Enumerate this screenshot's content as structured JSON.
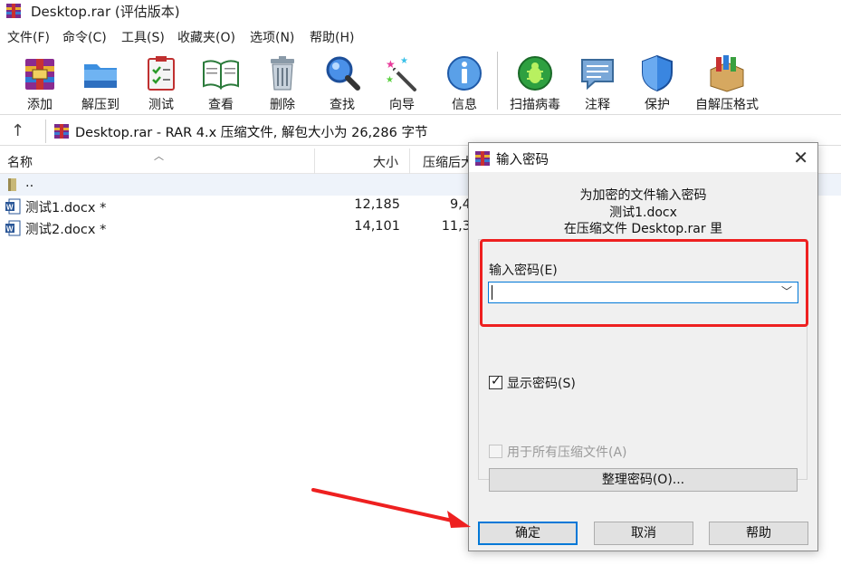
{
  "window": {
    "title": "Desktop.rar (评估版本)"
  },
  "menu": [
    "文件(F)",
    "命令(C)",
    "工具(S)",
    "收藏夹(O)",
    "选项(N)",
    "帮助(H)"
  ],
  "toolbar": [
    {
      "label": "添加",
      "icon": "add-archive-icon"
    },
    {
      "label": "解压到",
      "icon": "extract-folder-icon"
    },
    {
      "label": "测试",
      "icon": "test-clipboard-icon"
    },
    {
      "label": "查看",
      "icon": "view-book-icon"
    },
    {
      "label": "删除",
      "icon": "trash-icon"
    },
    {
      "label": "查找",
      "icon": "magnifier-icon"
    },
    {
      "label": "向导",
      "icon": "wizard-wand-icon"
    },
    {
      "label": "信息",
      "icon": "info-icon"
    },
    {
      "label": "扫描病毒",
      "icon": "virus-scan-icon"
    },
    {
      "label": "注释",
      "icon": "comment-bubble-icon"
    },
    {
      "label": "保护",
      "icon": "shield-icon"
    },
    {
      "label": "自解压格式",
      "icon": "sfx-box-icon"
    }
  ],
  "address": {
    "text": "Desktop.rar - RAR 4.x 压缩文件, 解包大小为 26,286 字节"
  },
  "columns": {
    "name": "名称",
    "size": "大小",
    "packed": "压缩后大"
  },
  "files": [
    {
      "name": "..",
      "size": "",
      "packed": ""
    },
    {
      "name": "测试1.docx *",
      "size": "12,185",
      "packed": "9,4"
    },
    {
      "name": "测试2.docx *",
      "size": "14,101",
      "packed": "11,3"
    }
  ],
  "dialog": {
    "title": "输入密码",
    "message_line1": "为加密的文件输入密码",
    "message_line2": "测试1.docx",
    "message_line3": "在压缩文件 Desktop.rar 里",
    "password_label": "输入密码(E)",
    "password_value": "",
    "show_password_label": "显示密码(S)",
    "show_password_checked": true,
    "use_for_all_label": "用于所有压缩文件(A)",
    "use_for_all_checked": false,
    "organize_button": "整理密码(O)...",
    "ok_button": "确定",
    "cancel_button": "取消",
    "help_button": "帮助"
  },
  "colors": {
    "accent": "#0078d7",
    "highlight_box": "#ee2020",
    "arrow": "#ee2020"
  }
}
